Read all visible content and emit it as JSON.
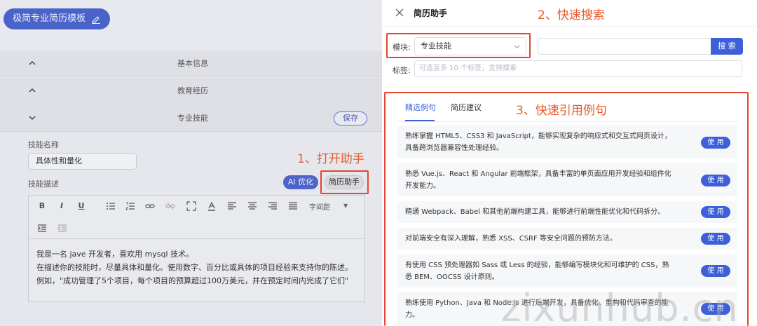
{
  "editor": {
    "title": "极简专业简历模板",
    "sections": [
      {
        "label": "基本信息"
      },
      {
        "label": "教育经历"
      },
      {
        "label": "专业技能"
      }
    ],
    "save_label": "保存",
    "skill_name_label": "技能名称",
    "skill_name_value": "具体性和量化",
    "skill_desc_label": "技能描述",
    "ai_label": "AI 优化",
    "helper_label": "简历助手",
    "toolbar": {
      "bold": "B",
      "italic": "I",
      "underline": "U",
      "spacing": "字间距"
    },
    "text_lines": [
      "我是一名 jave 开发者，喜欢用 mysql 技术。",
      "在描述你的技能时，尽量具体和量化。使用数字、百分比或具体的项目经验来支持你的陈述。",
      "例如，\"成功管理了5个项目，每个项目的预算超过100万美元，并在预定时间内完成了它们\""
    ]
  },
  "annotations": {
    "step1": "1、打开助手",
    "step2": "2、快速搜索",
    "step3": "3、快速引用例句"
  },
  "drawer": {
    "title": "简历助手",
    "module_label": "模块:",
    "module_value": "专业技能",
    "search_placeholder": "",
    "search_label": "搜 索",
    "tags_label": "标签:",
    "tags_placeholder": "可选至多 10 个标签，支持搜索",
    "tabs": [
      {
        "label": "精选例句",
        "active": true
      },
      {
        "label": "简历建议",
        "active": false
      }
    ],
    "use_label": "使 用",
    "examples": [
      {
        "lines": [
          "熟练掌握 HTML5、CSS3 和 JavaScript，能够实现复杂的响应式和交互式网页设计，",
          "具备跨浏览器兼容性处理经验。"
        ]
      },
      {
        "lines": [
          "熟悉 Vue.js、React 和 Angular 前端框架，具备丰富的单页面应用开发经验和组件化",
          "开发能力。"
        ]
      },
      {
        "lines": [
          "精通 Webpack、Babel 和其他前端构建工具，能够进行前端性能优化和代码拆分。"
        ]
      },
      {
        "lines": [
          "对前端安全有深入理解，熟悉 XSS、CSRF 等安全问题的预防方法。"
        ]
      },
      {
        "lines": [
          "有使用 CSS 预处理器如 Sass 或 Less 的经验，能够编写模块化和可维护的 CSS，熟",
          "悉 BEM、OOCSS 设计原则。"
        ]
      },
      {
        "lines": [
          "熟练使用 Python、Java 和 Node.js 进行后端开发，具备优化、重构和代码审查的能",
          "力。"
        ]
      }
    ]
  },
  "watermark": "zixunhub.cn",
  "colors": {
    "accent": "#3e5fd8",
    "annotation": "#e2462e"
  }
}
